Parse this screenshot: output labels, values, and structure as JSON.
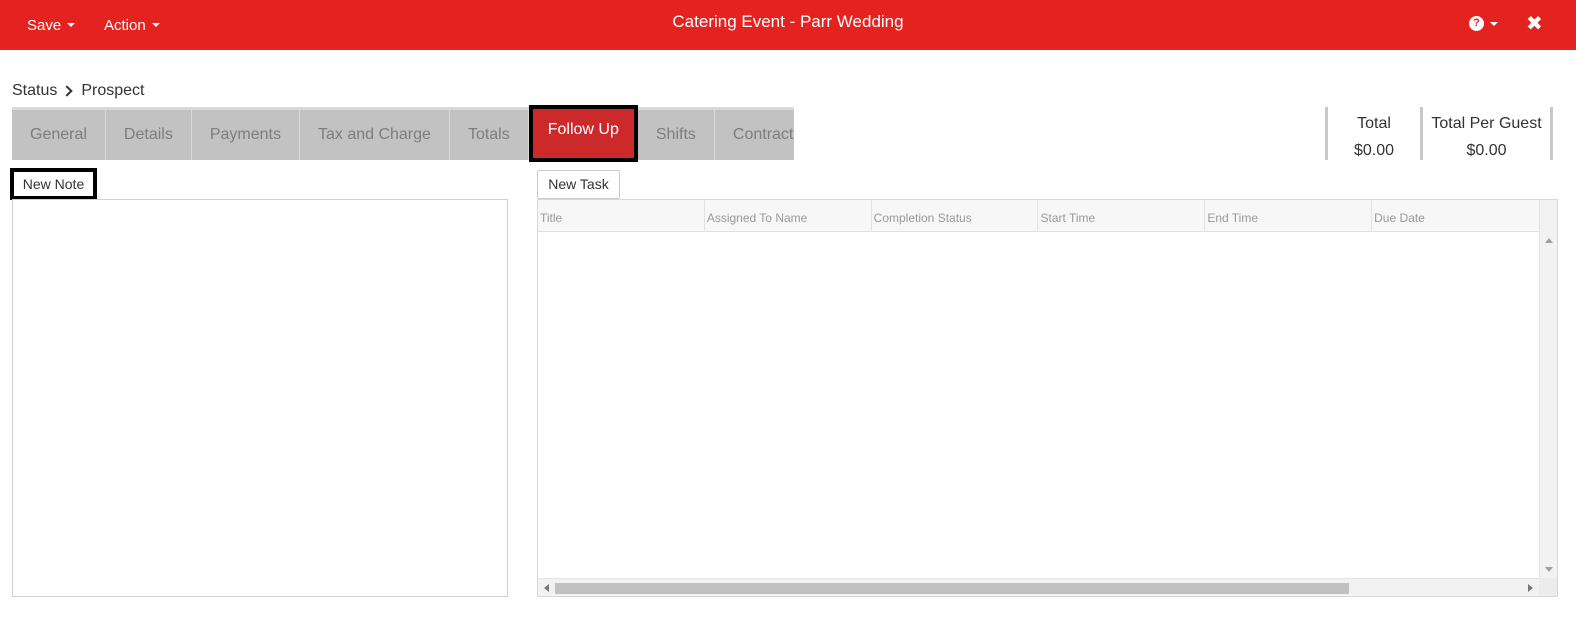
{
  "header": {
    "save_label": "Save",
    "action_label": "Action",
    "title": "Catering Event - Parr Wedding",
    "help_icon": "question-circle-icon",
    "close_icon": "close-icon",
    "brand_color": "#e42320"
  },
  "breadcrumb": {
    "label": "Status",
    "current": "Prospect"
  },
  "tabs": [
    {
      "label": "General"
    },
    {
      "label": "Details"
    },
    {
      "label": "Payments"
    },
    {
      "label": "Tax and Charge"
    },
    {
      "label": "Totals"
    },
    {
      "label": "Follow Up",
      "active": true
    },
    {
      "label": "Shifts"
    },
    {
      "label": "Contract"
    }
  ],
  "totals": {
    "total_label": "Total",
    "total_value": "$0.00",
    "per_guest_label": "Total Per Guest",
    "per_guest_value": "$0.00"
  },
  "notes": {
    "new_note_label": "New Note"
  },
  "tasks": {
    "new_task_label": "New Task",
    "columns": [
      "Title",
      "Assigned To Name",
      "Completion Status",
      "Start Time",
      "End Time",
      "Due Date"
    ],
    "rows": []
  }
}
